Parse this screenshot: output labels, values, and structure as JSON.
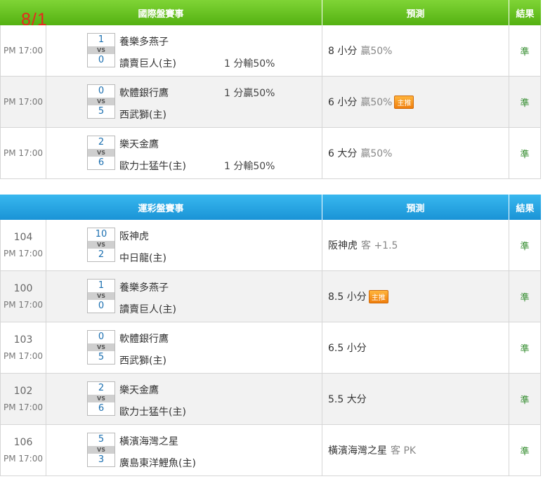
{
  "date": "8/1",
  "international": {
    "header": {
      "title": "國際盤賽事",
      "prediction": "預測",
      "result": "結果"
    },
    "rows": [
      {
        "time": "PM 17:00",
        "num": "",
        "away_score": "1",
        "home_score": "0",
        "vs": "VS",
        "away": "養樂多燕子",
        "home": "讀賣巨人(主)",
        "away_hc": "",
        "home_hc": "1 分輸50%",
        "pred": "8 小分",
        "pred_win": "贏50%",
        "badge": "",
        "result": "準"
      },
      {
        "time": "PM 17:00",
        "num": "",
        "away_score": "0",
        "home_score": "5",
        "vs": "VS",
        "away": "軟體銀行鷹",
        "home": "西武獅(主)",
        "away_hc": "1 分贏50%",
        "home_hc": "",
        "pred": "6 小分",
        "pred_win": "贏50%",
        "badge": "主推",
        "result": "準"
      },
      {
        "time": "PM 17:00",
        "num": "",
        "away_score": "2",
        "home_score": "6",
        "vs": "VS",
        "away": "樂天金鷹",
        "home": "歐力士猛牛(主)",
        "away_hc": "",
        "home_hc": "1 分輸50%",
        "pred": "6 大分",
        "pred_win": "贏50%",
        "badge": "",
        "result": "準"
      }
    ]
  },
  "lottery": {
    "header": {
      "title": "運彩盤賽事",
      "prediction": "預測",
      "result": "結果"
    },
    "rows": [
      {
        "time": "PM 17:00",
        "num": "104",
        "away_score": "10",
        "home_score": "2",
        "vs": "VS",
        "away": "阪神虎",
        "home": "中日龍(主)",
        "away_hc": "",
        "home_hc": "",
        "pred": "阪神虎",
        "pred_win": "客 +1.5",
        "badge": "",
        "result": "準"
      },
      {
        "time": "PM 17:00",
        "num": "100",
        "away_score": "1",
        "home_score": "0",
        "vs": "VS",
        "away": "養樂多燕子",
        "home": "讀賣巨人(主)",
        "away_hc": "",
        "home_hc": "",
        "pred": "8.5 小分",
        "pred_win": "",
        "badge": "主推",
        "result": "準"
      },
      {
        "time": "PM 17:00",
        "num": "103",
        "away_score": "0",
        "home_score": "5",
        "vs": "VS",
        "away": "軟體銀行鷹",
        "home": "西武獅(主)",
        "away_hc": "",
        "home_hc": "",
        "pred": "6.5 小分",
        "pred_win": "",
        "badge": "",
        "result": "準"
      },
      {
        "time": "PM 17:00",
        "num": "102",
        "away_score": "2",
        "home_score": "6",
        "vs": "VS",
        "away": "樂天金鷹",
        "home": "歐力士猛牛(主)",
        "away_hc": "",
        "home_hc": "",
        "pred": "5.5 大分",
        "pred_win": "",
        "badge": "",
        "result": "準"
      },
      {
        "time": "PM 17:00",
        "num": "106",
        "away_score": "5",
        "home_score": "3",
        "vs": "VS",
        "away": "橫濱海灣之星",
        "home": "廣島東洋鯉魚(主)",
        "away_hc": "",
        "home_hc": "",
        "pred": "橫濱海灣之星",
        "pred_win": "客 PK",
        "badge": "",
        "result": "準"
      }
    ]
  }
}
